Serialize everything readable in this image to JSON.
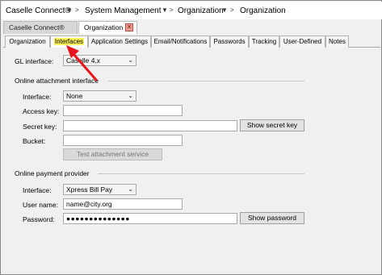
{
  "breadcrumb": {
    "app": "Caselle Connect®",
    "items": [
      "System Management",
      "Organization",
      "Organization"
    ]
  },
  "doc_tabs": {
    "tab1": "Caselle Connect®",
    "tab2": "Organization",
    "close_glyph": "✕"
  },
  "subtabs": [
    "Organization",
    "Interfaces",
    "Application Settings",
    "Email/Notifications",
    "Passwords",
    "Tracking",
    "User-Defined",
    "Notes"
  ],
  "active_subtab": "Interfaces",
  "highlight_color": "#fdf35a",
  "annotation_arrow_color": "#e8141c",
  "gl": {
    "label": "GL interface:",
    "value": "Caselle 4.x"
  },
  "attachment": {
    "section_title": "Online attachment interface",
    "interface_label": "Interface:",
    "interface_value": "None",
    "access_key_label": "Access key:",
    "access_key_value": "",
    "secret_key_label": "Secret key:",
    "secret_key_value": "",
    "show_secret_button": "Show secret key",
    "bucket_label": "Bucket:",
    "bucket_value": "",
    "test_button": "Test attachment service"
  },
  "payment": {
    "section_title": "Online payment provider",
    "interface_label": "Interface:",
    "interface_value": "Xpress Bill Pay",
    "username_label": "User name:",
    "username_value": "name@city.org",
    "password_label": "Password:",
    "password_value": "●●●●●●●●●●●●●●",
    "show_password_button": "Show password"
  }
}
